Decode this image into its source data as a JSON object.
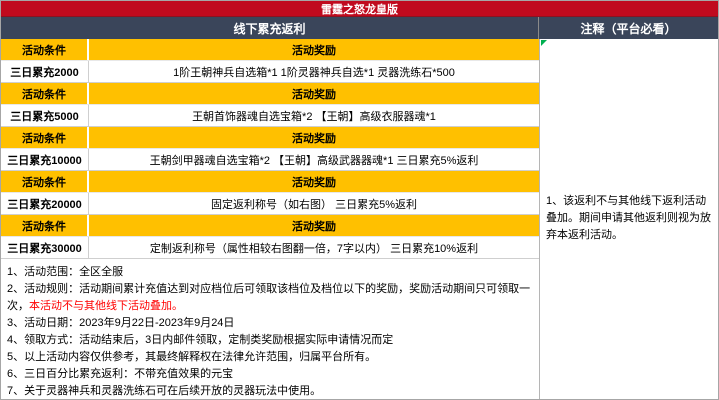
{
  "title": "雷霆之怒龙皇版",
  "left_header": "线下累充返利",
  "right_header": "注释（平台必看）",
  "table": {
    "header_condition": "活动条件",
    "header_reward": "活动奖励",
    "rows": [
      {
        "condition": "三日累充2000",
        "reward": "1阶王朝神兵自选箱*1 1阶灵器神兵自选*1 灵器洗练石*500"
      },
      {
        "condition": "三日累充5000",
        "reward": "王朝首饰器魂自选宝箱*2 【王朝】高级衣服器魂*1"
      },
      {
        "condition": "三日累充10000",
        "reward": "王朝剑甲器魂自选宝箱*2 【王朝】高级武器器魂*1 三日累充5%返利"
      },
      {
        "condition": "三日累充20000",
        "reward": "固定返利称号（如右图） 三日累充5%返利"
      },
      {
        "condition": "三日累充30000",
        "reward": "定制返利称号（属性相较右图翻一倍，7字以内） 三日累充10%返利"
      }
    ]
  },
  "notes": {
    "n1": "1、活动范围：全区全服",
    "n2_black": "2、活动规则：活动期间累计充值达到对应档位后可领取该档位及档位以下的奖励，奖励活动期间只可领取一次，",
    "n2_red": "本活动不与其他线下活动叠加。",
    "n3": "3、活动日期：2023年9月22日-2023年9月24日",
    "n4": "4、领取方式：活动结束后，3日内邮件领取，定制类奖励根据实际申请情况而定",
    "n5": "5、以上活动内容仅供参考，其最终解释权在法律允许范围，归属平台所有。",
    "n6": "6、三日百分比累充返利：不带充值效果的元宝",
    "n7": "7、关于灵器神兵和灵器洗练石可在后续开放的灵器玩法中使用。"
  },
  "annotation": "1、该返利不与其他线下返利活动叠加。期间申请其他返利则视为放弃本返利活动。",
  "colors": {
    "title_bar": "#c00a1e",
    "section_header": "#3a455a",
    "table_header": "#ffc000",
    "warning_text": "#ff0000",
    "comment_marker": "#00b050"
  }
}
